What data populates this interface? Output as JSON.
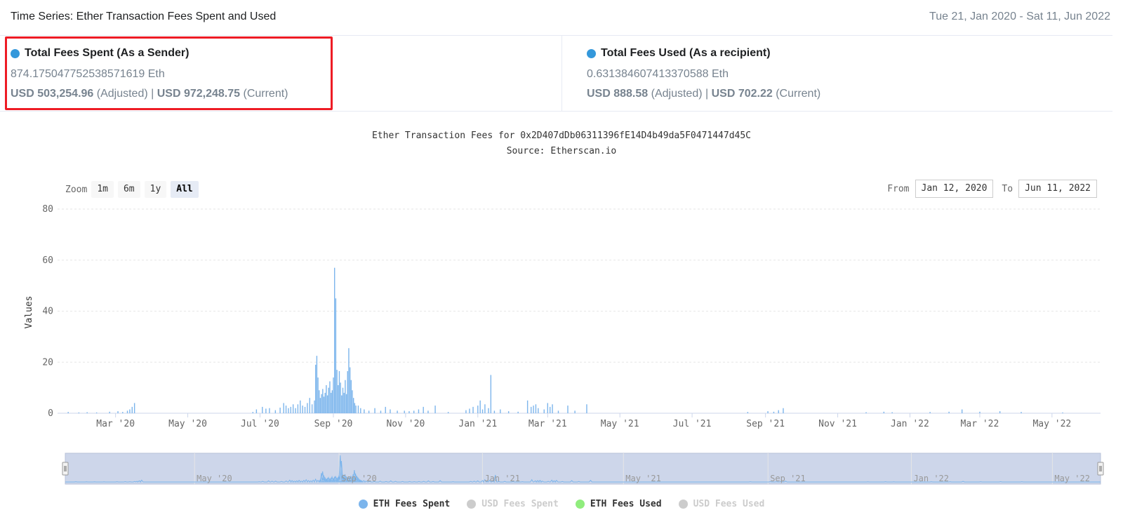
{
  "header": {
    "title": "Time Series: Ether Transaction Fees Spent and Used",
    "range_start": "Tue 21, Jan 2020",
    "range_sep": " - ",
    "range_end": "Sat 11, Jun 2022"
  },
  "stats": {
    "spent": {
      "heading": "Total Fees Spent (As a Sender)",
      "eth": "874.175047752538571619 Eth",
      "usd_adjusted": "USD 503,254.96",
      "adjusted_label": " (Adjusted) | ",
      "usd_current": "USD 972,248.75",
      "current_label": " (Current)"
    },
    "used": {
      "heading": "Total Fees Used (As a recipient)",
      "eth": "0.631384607413370588 Eth",
      "usd_adjusted": "USD 888.58",
      "adjusted_label": " (Adjusted) | ",
      "usd_current": "USD 702.22",
      "current_label": " (Current)"
    }
  },
  "chart": {
    "title": "Ether Transaction Fees for 0x2D407dDb06311396fE14D4b49da5F0471447d45C",
    "subtitle": "Source: Etherscan.io",
    "zoom_label": "Zoom",
    "zoom_buttons": [
      "1m",
      "6m",
      "1y",
      "All"
    ],
    "zoom_active": "All",
    "from_label": "From",
    "from_value": "Jan 12, 2020",
    "to_label": "To",
    "to_value": "Jun 11, 2022",
    "legend": [
      {
        "name": "ETH Fees Spent",
        "color": "#7cb5ec",
        "active": true
      },
      {
        "name": "USD Fees Spent",
        "color": "#cccccc",
        "active": false
      },
      {
        "name": "ETH Fees Used",
        "color": "#90ed7d",
        "active": true
      },
      {
        "name": "USD Fees Used",
        "color": "#cccccc",
        "active": false
      }
    ]
  },
  "chart_data": {
    "type": "bar",
    "title": "Ether Transaction Fees for 0x2D407dDb06311396fE14D4b49da5F0471447d45C",
    "subtitle": "Source: Etherscan.io",
    "xlabel": "",
    "ylabel": "Values",
    "x_range": [
      "2020-01-12",
      "2022-06-11"
    ],
    "ylim": [
      0,
      80
    ],
    "y_ticks": [
      0,
      20,
      40,
      60,
      80
    ],
    "x_tick_labels": [
      {
        "date": "2020-03-01",
        "label": "Mar '20"
      },
      {
        "date": "2020-05-01",
        "label": "May '20"
      },
      {
        "date": "2020-07-01",
        "label": "Jul '20"
      },
      {
        "date": "2020-09-01",
        "label": "Sep '20"
      },
      {
        "date": "2020-11-01",
        "label": "Nov '20"
      },
      {
        "date": "2021-01-01",
        "label": "Jan '21"
      },
      {
        "date": "2021-03-01",
        "label": "Mar '21"
      },
      {
        "date": "2021-05-01",
        "label": "May '21"
      },
      {
        "date": "2021-07-01",
        "label": "Jul '21"
      },
      {
        "date": "2021-09-01",
        "label": "Sep '21"
      },
      {
        "date": "2021-11-01",
        "label": "Nov '21"
      },
      {
        "date": "2022-01-01",
        "label": "Jan '22"
      },
      {
        "date": "2022-03-01",
        "label": "Mar '22"
      },
      {
        "date": "2022-05-01",
        "label": "May '22"
      }
    ],
    "navigator_tick_labels": [
      {
        "date": "2020-05-01",
        "label": "May '20"
      },
      {
        "date": "2020-09-01",
        "label": "Sep '20"
      },
      {
        "date": "2021-01-01",
        "label": "Jan '21"
      },
      {
        "date": "2021-05-01",
        "label": "May '21"
      },
      {
        "date": "2021-09-01",
        "label": "Sep '21"
      },
      {
        "date": "2022-01-01",
        "label": "Jan '22"
      },
      {
        "date": "2022-05-01",
        "label": "May '22"
      }
    ],
    "grid": true,
    "legend_position": "bottom",
    "series": [
      {
        "name": "ETH Fees Spent",
        "color": "#7cb5ec",
        "points": [
          [
            "2020-01-21",
            0.5
          ],
          [
            "2020-01-30",
            0.3
          ],
          [
            "2020-02-06",
            0.4
          ],
          [
            "2020-02-14",
            0.3
          ],
          [
            "2020-02-25",
            0.6
          ],
          [
            "2020-03-03",
            0.8
          ],
          [
            "2020-03-07",
            0.5
          ],
          [
            "2020-03-11",
            1.0
          ],
          [
            "2020-03-13",
            1.5
          ],
          [
            "2020-03-15",
            2.5
          ],
          [
            "2020-03-17",
            4.0
          ],
          [
            "2020-06-25",
            0.5
          ],
          [
            "2020-06-28",
            1.5
          ],
          [
            "2020-07-03",
            2.5
          ],
          [
            "2020-07-06",
            1.8
          ],
          [
            "2020-07-09",
            2.0
          ],
          [
            "2020-07-14",
            1.2
          ],
          [
            "2020-07-18",
            2.2
          ],
          [
            "2020-07-21",
            4.0
          ],
          [
            "2020-07-23",
            3.0
          ],
          [
            "2020-07-25",
            2.0
          ],
          [
            "2020-07-27",
            2.5
          ],
          [
            "2020-07-29",
            3.5
          ],
          [
            "2020-07-31",
            2.0
          ],
          [
            "2020-08-02",
            3.5
          ],
          [
            "2020-08-04",
            5.0
          ],
          [
            "2020-08-06",
            3.0
          ],
          [
            "2020-08-08",
            2.5
          ],
          [
            "2020-08-10",
            4.0
          ],
          [
            "2020-08-12",
            6.0
          ],
          [
            "2020-08-14",
            3.5
          ],
          [
            "2020-08-16",
            5.0
          ],
          [
            "2020-08-17",
            19.0
          ],
          [
            "2020-08-18",
            22.5
          ],
          [
            "2020-08-19",
            14.0
          ],
          [
            "2020-08-20",
            9.0
          ],
          [
            "2020-08-21",
            6.0
          ],
          [
            "2020-08-22",
            7.5
          ],
          [
            "2020-08-23",
            9.5
          ],
          [
            "2020-08-24",
            6.5
          ],
          [
            "2020-08-25",
            8.0
          ],
          [
            "2020-08-26",
            11.0
          ],
          [
            "2020-08-27",
            7.0
          ],
          [
            "2020-08-28",
            10.0
          ],
          [
            "2020-08-29",
            12.5
          ],
          [
            "2020-08-30",
            8.0
          ],
          [
            "2020-08-31",
            9.0
          ],
          [
            "2020-09-01",
            14.0
          ],
          [
            "2020-09-02",
            57.0
          ],
          [
            "2020-09-03",
            45.0
          ],
          [
            "2020-09-04",
            17.0
          ],
          [
            "2020-09-05",
            11.0
          ],
          [
            "2020-09-06",
            16.5
          ],
          [
            "2020-09-07",
            12.0
          ],
          [
            "2020-09-08",
            7.0
          ],
          [
            "2020-09-09",
            10.0
          ],
          [
            "2020-09-10",
            8.0
          ],
          [
            "2020-09-11",
            13.0
          ],
          [
            "2020-09-12",
            7.5
          ],
          [
            "2020-09-13",
            16.5
          ],
          [
            "2020-09-14",
            25.5
          ],
          [
            "2020-09-15",
            18.0
          ],
          [
            "2020-09-16",
            13.0
          ],
          [
            "2020-09-17",
            9.0
          ],
          [
            "2020-09-18",
            6.0
          ],
          [
            "2020-09-19",
            4.0
          ],
          [
            "2020-09-20",
            3.0
          ],
          [
            "2020-09-22",
            3.0
          ],
          [
            "2020-09-24",
            2.0
          ],
          [
            "2020-09-27",
            1.5
          ],
          [
            "2020-10-01",
            1.0
          ],
          [
            "2020-10-06",
            2.0
          ],
          [
            "2020-10-11",
            1.0
          ],
          [
            "2020-10-15",
            2.5
          ],
          [
            "2020-10-19",
            1.5
          ],
          [
            "2020-10-25",
            1.0
          ],
          [
            "2020-10-31",
            1.0
          ],
          [
            "2020-11-04",
            0.8
          ],
          [
            "2020-11-08",
            1.0
          ],
          [
            "2020-11-12",
            1.5
          ],
          [
            "2020-11-16",
            2.5
          ],
          [
            "2020-11-20",
            1.0
          ],
          [
            "2020-11-26",
            3.0
          ],
          [
            "2020-12-07",
            0.5
          ],
          [
            "2020-12-22",
            1.2
          ],
          [
            "2020-12-25",
            1.8
          ],
          [
            "2020-12-28",
            2.5
          ],
          [
            "2021-01-01",
            3.0
          ],
          [
            "2021-01-03",
            5.0
          ],
          [
            "2021-01-05",
            1.5
          ],
          [
            "2021-01-07",
            3.5
          ],
          [
            "2021-01-10",
            2.0
          ],
          [
            "2021-01-12",
            15.0
          ],
          [
            "2021-01-15",
            1.0
          ],
          [
            "2021-01-20",
            1.5
          ],
          [
            "2021-01-27",
            0.8
          ],
          [
            "2021-02-04",
            0.6
          ],
          [
            "2021-02-12",
            5.0
          ],
          [
            "2021-02-15",
            2.5
          ],
          [
            "2021-02-17",
            3.0
          ],
          [
            "2021-02-19",
            3.5
          ],
          [
            "2021-02-21",
            2.0
          ],
          [
            "2021-02-26",
            1.5
          ],
          [
            "2021-03-01",
            4.0
          ],
          [
            "2021-03-03",
            2.5
          ],
          [
            "2021-03-05",
            3.5
          ],
          [
            "2021-03-10",
            1.0
          ],
          [
            "2021-03-18",
            3.0
          ],
          [
            "2021-03-24",
            1.0
          ],
          [
            "2021-04-03",
            3.5
          ],
          [
            "2021-08-17",
            0.5
          ],
          [
            "2021-09-03",
            0.8
          ],
          [
            "2021-09-08",
            0.6
          ],
          [
            "2021-09-12",
            1.2
          ],
          [
            "2021-09-16",
            2.0
          ],
          [
            "2021-11-25",
            0.4
          ],
          [
            "2021-12-10",
            0.6
          ],
          [
            "2021-12-17",
            0.4
          ],
          [
            "2022-01-18",
            0.5
          ],
          [
            "2022-02-03",
            0.6
          ],
          [
            "2022-02-14",
            1.5
          ],
          [
            "2022-03-01",
            0.6
          ],
          [
            "2022-03-18",
            0.8
          ],
          [
            "2022-04-05",
            0.5
          ],
          [
            "2022-05-10",
            0.3
          ]
        ]
      },
      {
        "name": "ETH Fees Used",
        "color": "#90ed7d",
        "points": []
      }
    ]
  }
}
